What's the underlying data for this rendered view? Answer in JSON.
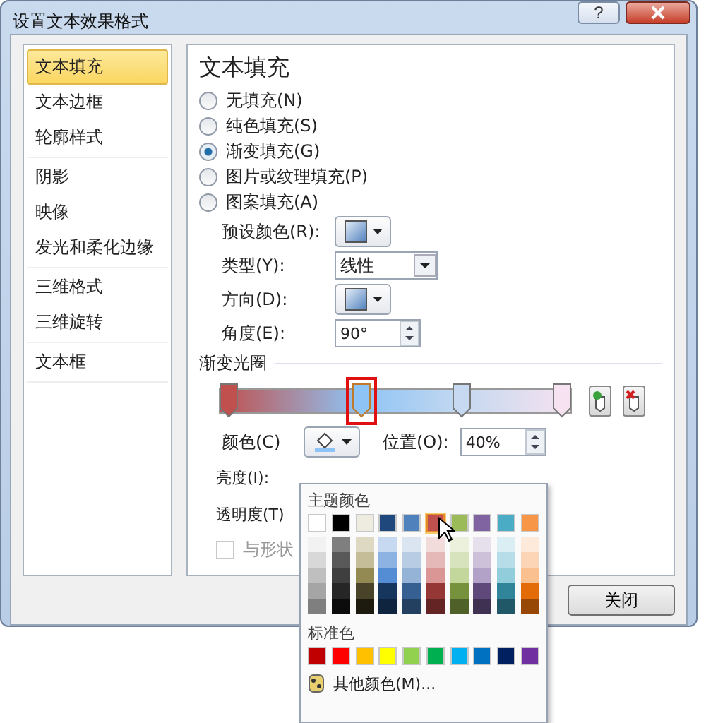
{
  "window": {
    "title": "设置文本效果格式",
    "help": "?"
  },
  "sidebar": {
    "groups": [
      [
        {
          "label": "文本填充",
          "selected": true
        },
        {
          "label": "文本边框",
          "selected": false
        },
        {
          "label": "轮廓样式",
          "selected": false
        }
      ],
      [
        {
          "label": "阴影",
          "selected": false
        },
        {
          "label": "映像",
          "selected": false
        },
        {
          "label": "发光和柔化边缘",
          "selected": false
        }
      ],
      [
        {
          "label": "三维格式",
          "selected": false
        },
        {
          "label": "三维旋转",
          "selected": false
        }
      ],
      [
        {
          "label": "文本框",
          "selected": false
        }
      ]
    ]
  },
  "panel": {
    "heading": "文本填充",
    "fill_options": [
      {
        "label": "无填充(N)",
        "selected": false
      },
      {
        "label": "纯色填充(S)",
        "selected": false
      },
      {
        "label": "渐变填充(G)",
        "selected": true
      },
      {
        "label": "图片或纹理填充(P)",
        "selected": false
      },
      {
        "label": "图案填充(A)",
        "selected": false
      }
    ],
    "preset_label": "预设颜色(R):",
    "type_label": "类型(Y):",
    "type_value": "线性",
    "direction_label": "方向(D):",
    "angle_label": "角度(E):",
    "angle_value": "90°",
    "stops_heading": "渐变光圈",
    "stops": [
      {
        "color": "#c0504d",
        "level": 0,
        "selected": false
      },
      {
        "color": "#8ec4f5",
        "level": 0.4,
        "selected": true
      },
      {
        "color": "#c6d9f0",
        "level": 0.7,
        "selected": false
      },
      {
        "color": "#f6e2f0",
        "level": 1,
        "selected": false
      }
    ],
    "color_label": "颜色(C)",
    "position_label": "位置(O):",
    "position_value": "40%",
    "brightness_label": "亮度(I):",
    "transparency_label": "透明度(T)",
    "rotate_checkbox": {
      "label": "与形状",
      "checked": false,
      "disabled": true
    }
  },
  "close_button": "关闭",
  "color_menu": {
    "theme_heading": "主题颜色",
    "theme": [
      {
        "color": "#ffffff",
        "selected": false,
        "shades": [
          {
            "color": "#f2f2f2"
          },
          {
            "color": "#d8d8d8"
          },
          {
            "color": "#bfbfbf"
          },
          {
            "color": "#a5a5a5"
          },
          {
            "color": "#7f7f7f"
          }
        ]
      },
      {
        "color": "#000000",
        "selected": false,
        "shades": [
          {
            "color": "#7f7f7f"
          },
          {
            "color": "#595959"
          },
          {
            "color": "#3f3f3f"
          },
          {
            "color": "#262626"
          },
          {
            "color": "#0c0c0c"
          }
        ]
      },
      {
        "color": "#eeece1",
        "selected": false,
        "shades": [
          {
            "color": "#ddd9c3"
          },
          {
            "color": "#c4bd97"
          },
          {
            "color": "#938953"
          },
          {
            "color": "#494429"
          },
          {
            "color": "#1d1b10"
          }
        ]
      },
      {
        "color": "#1f497d",
        "selected": false,
        "shades": [
          {
            "color": "#c6d9f0"
          },
          {
            "color": "#8db3e2"
          },
          {
            "color": "#548dd4"
          },
          {
            "color": "#17365d"
          },
          {
            "color": "#0f243e"
          }
        ]
      },
      {
        "color": "#4f81bd",
        "selected": false,
        "shades": [
          {
            "color": "#dbe5f1"
          },
          {
            "color": "#b8cce4"
          },
          {
            "color": "#95b3d7"
          },
          {
            "color": "#366092"
          },
          {
            "color": "#244061"
          }
        ]
      },
      {
        "color": "#c0504d",
        "selected": true,
        "shades": [
          {
            "color": "#f2dcdb"
          },
          {
            "color": "#e5b9b7"
          },
          {
            "color": "#d99694"
          },
          {
            "color": "#953734"
          },
          {
            "color": "#632423"
          }
        ]
      },
      {
        "color": "#9bbb59",
        "selected": false,
        "shades": [
          {
            "color": "#ebf1dd"
          },
          {
            "color": "#d7e3bc"
          },
          {
            "color": "#c3d69b"
          },
          {
            "color": "#76923c"
          },
          {
            "color": "#4f6128"
          }
        ]
      },
      {
        "color": "#8064a2",
        "selected": false,
        "shades": [
          {
            "color": "#e5e0ec"
          },
          {
            "color": "#ccc1d9"
          },
          {
            "color": "#b2a2c7"
          },
          {
            "color": "#5f497a"
          },
          {
            "color": "#3f3151"
          }
        ]
      },
      {
        "color": "#4bacc6",
        "selected": false,
        "shades": [
          {
            "color": "#dbeef3"
          },
          {
            "color": "#b7dde8"
          },
          {
            "color": "#92cddc"
          },
          {
            "color": "#31859b"
          },
          {
            "color": "#205867"
          }
        ]
      },
      {
        "color": "#f79646",
        "selected": false,
        "shades": [
          {
            "color": "#fdeada"
          },
          {
            "color": "#fbd5b5"
          },
          {
            "color": "#fac08f"
          },
          {
            "color": "#e36c09"
          },
          {
            "color": "#974806"
          }
        ]
      }
    ],
    "standard_heading": "标准色",
    "standard": [
      {
        "color": "#c00000"
      },
      {
        "color": "#ff0000"
      },
      {
        "color": "#ffc000"
      },
      {
        "color": "#ffff00"
      },
      {
        "color": "#92d050"
      },
      {
        "color": "#00b050"
      },
      {
        "color": "#00b0f0"
      },
      {
        "color": "#0070c0"
      },
      {
        "color": "#002060"
      },
      {
        "color": "#7030a0"
      }
    ],
    "more": "其他颜色(M)..."
  }
}
